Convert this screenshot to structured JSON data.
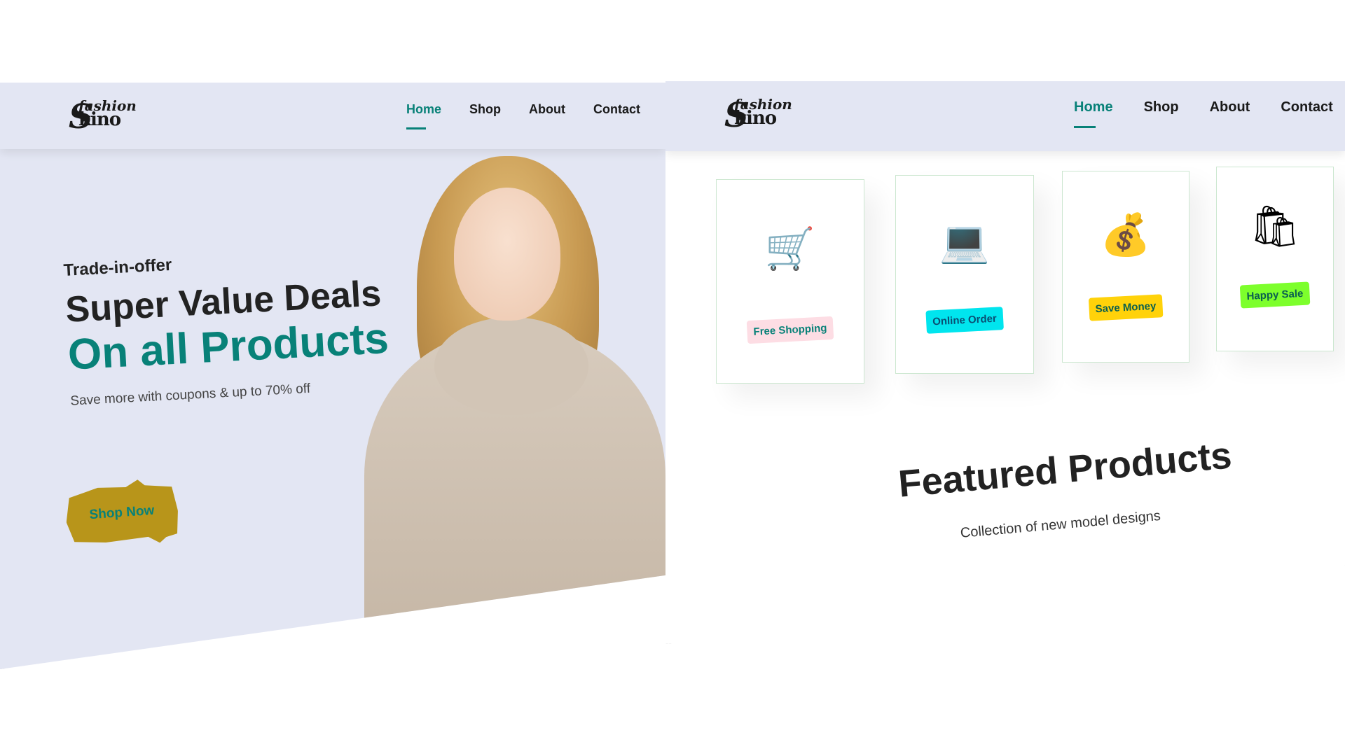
{
  "left_page": {
    "logo": {
      "top": "fashion",
      "bottom": "kino",
      "initial": "S"
    },
    "nav": [
      "Home",
      "Shop",
      "About",
      "Contact"
    ],
    "hero": {
      "eyebrow": "Trade-in-offer",
      "headline": "Super Value Deals",
      "highlight": "On all Products",
      "subtext": "Save more with coupons & up to 70% off",
      "button": "Shop Now"
    }
  },
  "right_page": {
    "logo": {
      "top": "fashion",
      "bottom": "kino",
      "initial": "S"
    },
    "nav": [
      "Home",
      "Shop",
      "About",
      "Contact"
    ],
    "features": [
      {
        "label": "Free Shopping",
        "icon": "cart-icon",
        "glyph": "🛒",
        "color": "#fddde4"
      },
      {
        "label": "Online Order",
        "icon": "laptop-icon",
        "glyph": "💻",
        "color": "#00e5ee"
      },
      {
        "label": "Save Money",
        "icon": "coins-icon",
        "glyph": "💰",
        "color": "#ffd20a"
      },
      {
        "label": "Happy Sale",
        "icon": "shopping-bags-icon",
        "glyph": "🛍",
        "color": "#7dff2c"
      }
    ],
    "section": {
      "title": "Featured Products",
      "subtitle": "Collection of new model designs"
    }
  },
  "colors": {
    "accent": "#088178",
    "nav_bg": "#e3e6f3",
    "button_bg": "#b8951a"
  }
}
